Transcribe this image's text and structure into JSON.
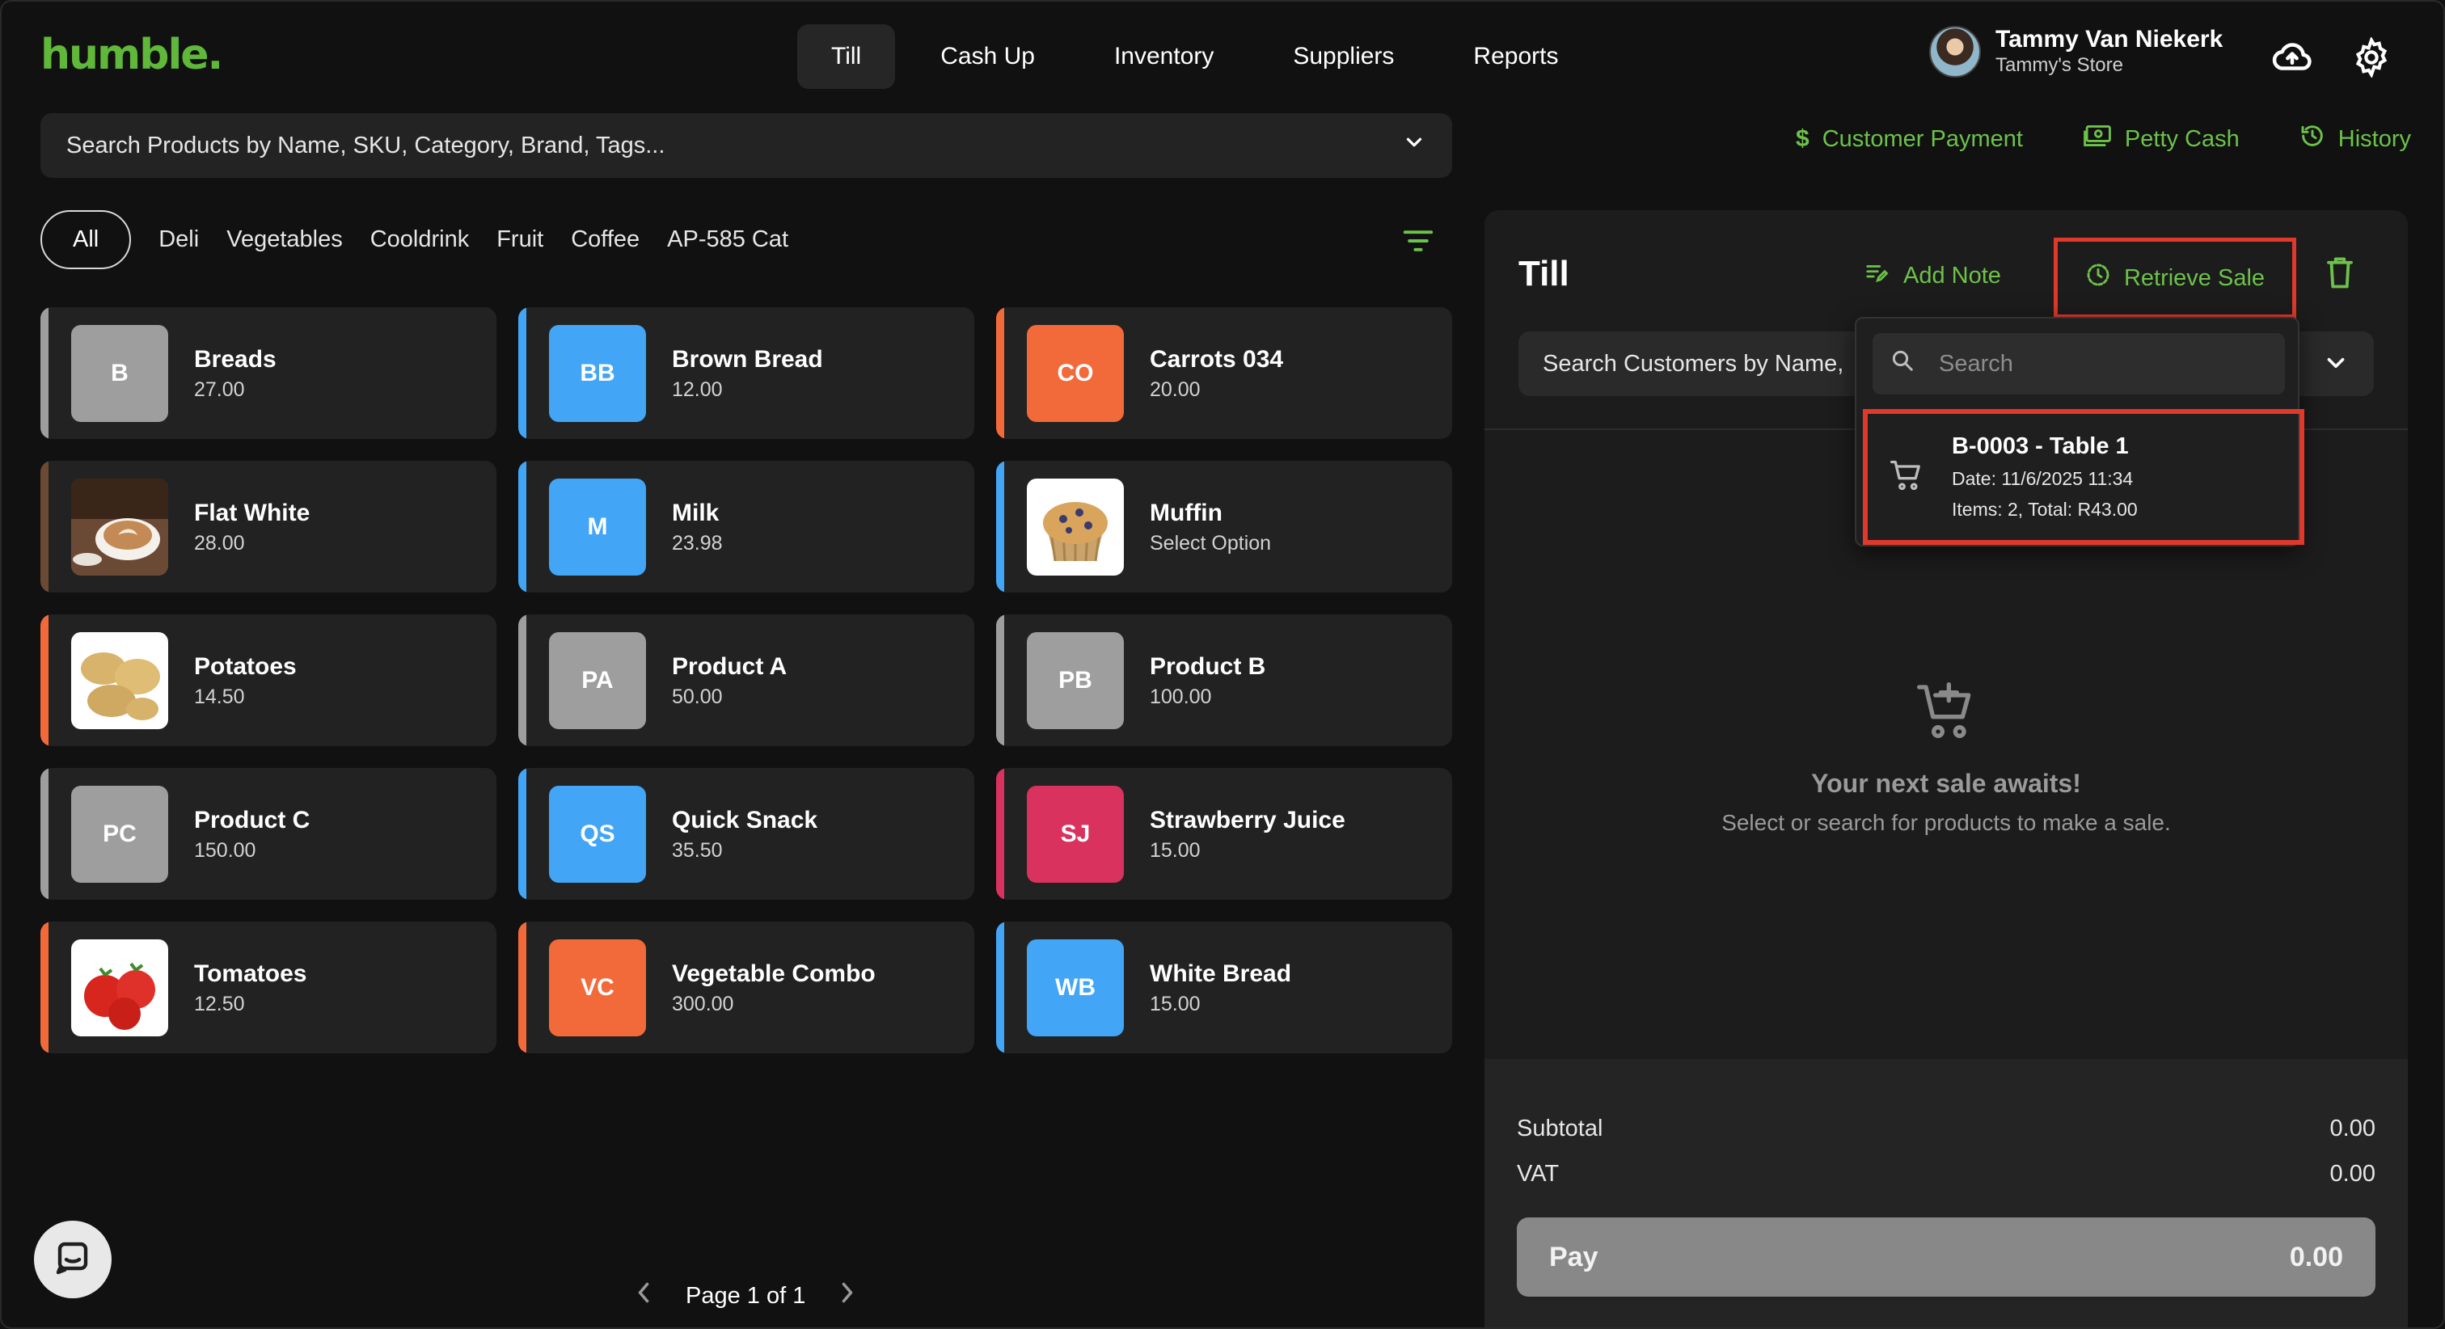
{
  "app": {
    "logo": "humble."
  },
  "nav": {
    "tabs": [
      {
        "label": "Till",
        "active": true
      },
      {
        "label": "Cash Up"
      },
      {
        "label": "Inventory"
      },
      {
        "label": "Suppliers"
      },
      {
        "label": "Reports"
      }
    ]
  },
  "user": {
    "name": "Tammy Van Niekerk",
    "store": "Tammy's Store"
  },
  "product_search": {
    "placeholder": "Search Products by Name, SKU, Category, Brand, Tags..."
  },
  "quick_actions": {
    "customer_payment": "Customer Payment",
    "petty_cash": "Petty Cash",
    "history": "History"
  },
  "categories": [
    "All",
    "Deli",
    "Vegetables",
    "Cooldrink",
    "Fruit",
    "Coffee",
    "AP-585 Cat"
  ],
  "products": [
    {
      "name": "Breads",
      "price": "27.00",
      "initials": "B",
      "color": "#9e9e9e"
    },
    {
      "name": "Brown Bread",
      "price": "12.00",
      "initials": "BB",
      "color": "#42a5f5"
    },
    {
      "name": "Carrots 034",
      "price": "20.00",
      "initials": "CO",
      "color": "#f26a3a"
    },
    {
      "name": "Flat White",
      "price": "28.00",
      "initials": "",
      "color": "#6b4a35",
      "image": "coffee"
    },
    {
      "name": "Milk",
      "price": "23.98",
      "initials": "M",
      "color": "#42a5f5"
    },
    {
      "name": "Muffin",
      "price": "Select Option",
      "initials": "",
      "color": "#42a5f5",
      "image": "muffin"
    },
    {
      "name": "Potatoes",
      "price": "14.50",
      "initials": "",
      "color": "#f26a3a",
      "image": "potatoes"
    },
    {
      "name": "Product A",
      "price": "50.00",
      "initials": "PA",
      "color": "#9e9e9e"
    },
    {
      "name": "Product B",
      "price": "100.00",
      "initials": "PB",
      "color": "#9e9e9e"
    },
    {
      "name": "Product C",
      "price": "150.00",
      "initials": "PC",
      "color": "#9e9e9e"
    },
    {
      "name": "Quick Snack",
      "price": "35.50",
      "initials": "QS",
      "color": "#42a5f5"
    },
    {
      "name": "Strawberry Juice",
      "price": "15.00",
      "initials": "SJ",
      "color": "#d9325e"
    },
    {
      "name": "Tomatoes",
      "price": "12.50",
      "initials": "",
      "color": "#f26a3a",
      "image": "tomatoes"
    },
    {
      "name": "Vegetable Combo",
      "price": "300.00",
      "initials": "VC",
      "color": "#f26a3a"
    },
    {
      "name": "White Bread",
      "price": "15.00",
      "initials": "WB",
      "color": "#42a5f5"
    }
  ],
  "pagination": {
    "label": "Page 1 of 1"
  },
  "till": {
    "title": "Till",
    "add_note": "Add Note",
    "retrieve_sale": "Retrieve Sale",
    "customer_search_placeholder": "Search Customers by Name,",
    "empty_title": "Your next sale awaits!",
    "empty_sub": "Select or search for products to make a sale.",
    "subtotal_label": "Subtotal",
    "subtotal_value": "0.00",
    "vat_label": "VAT",
    "vat_value": "0.00",
    "pay_label": "Pay",
    "pay_value": "0.00"
  },
  "retrieve_dropdown": {
    "search_placeholder": "Search",
    "sales": [
      {
        "ref": "B-0003 - Table 1",
        "date": "Date: 11/6/2025 11:34",
        "summary": "Items: 2, Total: R43.00"
      }
    ]
  },
  "colors": {
    "accent": "#6cc24a",
    "highlight": "#e0392b",
    "background": "#111111"
  }
}
